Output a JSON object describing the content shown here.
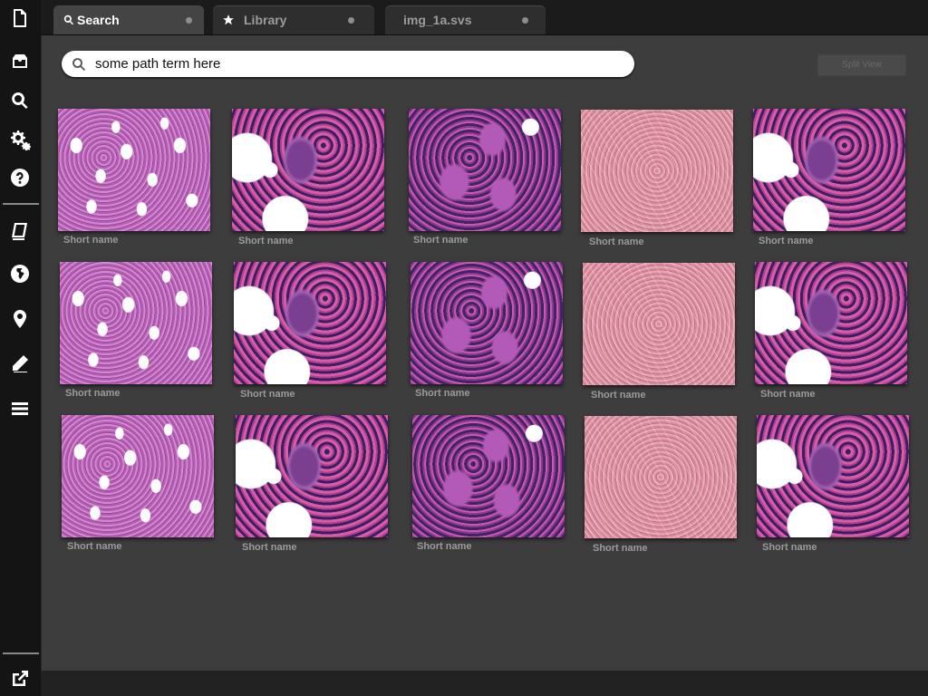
{
  "tabs": [
    {
      "label": "Search",
      "icon": "search-icon",
      "active": true
    },
    {
      "label": "Library",
      "icon": "star-icon",
      "active": false
    },
    {
      "label": "img_1a.svs",
      "icon": "",
      "active": false
    }
  ],
  "search": {
    "value": "some path term here"
  },
  "toolbar": {
    "split_view_label": "Split View"
  },
  "sidebar": {
    "icons": [
      "file-icon",
      "inbox-icon",
      "search-icon",
      "settings-icon",
      "help-icon",
      "book-icon",
      "globe-icon",
      "location-pin-icon",
      "pencil-icon",
      "menu-icon",
      "external-link-icon"
    ]
  },
  "thumbnails": [
    {
      "label": "Short name",
      "texture": "adipose-marrow"
    },
    {
      "label": "Short name",
      "texture": "megakaryocyte"
    },
    {
      "label": "Short name",
      "texture": "clustered-cells"
    },
    {
      "label": "Short name",
      "texture": "pink-tissue"
    },
    {
      "label": "Short name",
      "texture": "megakaryocyte"
    },
    {
      "label": "Short name",
      "texture": "adipose-marrow"
    },
    {
      "label": "Short name",
      "texture": "megakaryocyte"
    },
    {
      "label": "Short name",
      "texture": "clustered-cells"
    },
    {
      "label": "Short name",
      "texture": "pink-tissue"
    },
    {
      "label": "Short name",
      "texture": "megakaryocyte"
    },
    {
      "label": "Short name",
      "texture": "adipose-marrow"
    },
    {
      "label": "Short name",
      "texture": "megakaryocyte"
    },
    {
      "label": "Short name",
      "texture": "clustered-cells"
    },
    {
      "label": "Short name",
      "texture": "pink-tissue"
    },
    {
      "label": "Short name",
      "texture": "megakaryocyte"
    }
  ]
}
